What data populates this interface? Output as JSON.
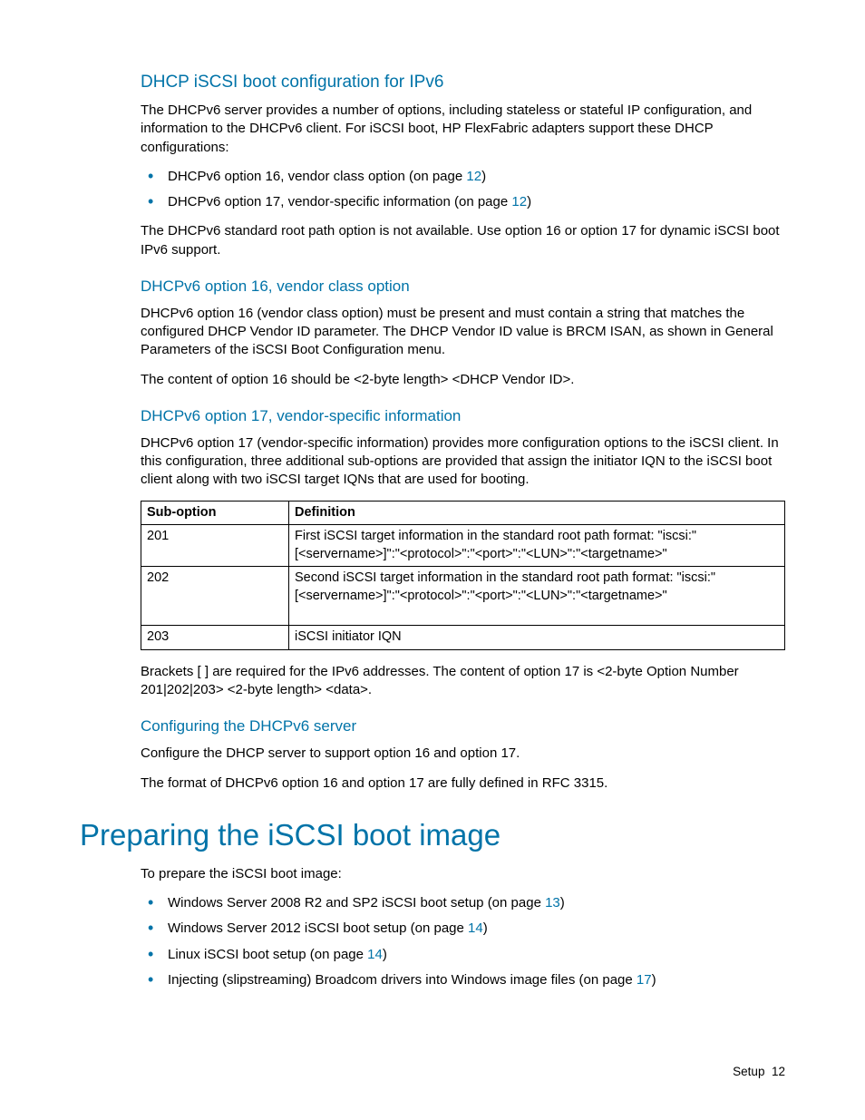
{
  "sec1": {
    "title": "DHCP iSCSI boot configuration for IPv6",
    "p1": "The DHCPv6 server provides a number of options, including stateless or stateful IP configuration, and information to the DHCPv6 client. For iSCSI boot, HP FlexFabric adapters support these DHCP configurations:",
    "bullets": [
      {
        "text_a": "DHCPv6 option 16, vendor class option (on page ",
        "link": "12",
        "text_b": ")"
      },
      {
        "text_a": "DHCPv6 option 17, vendor-specific information (on page ",
        "link": "12",
        "text_b": ")"
      }
    ],
    "p2": "The DHCPv6 standard root path option is not available. Use option 16 or option 17 for dynamic iSCSI boot IPv6 support."
  },
  "sec2": {
    "title": "DHCPv6 option 16, vendor class option",
    "p1": "DHCPv6 option 16 (vendor class option) must be present and must contain a string that matches the configured DHCP Vendor ID parameter. The DHCP Vendor ID value is BRCM ISAN, as shown in General Parameters of the iSCSI Boot Configuration menu.",
    "p2": "The content of option 16 should be <2-byte length> <DHCP Vendor ID>."
  },
  "sec3": {
    "title": "DHCPv6 option 17, vendor-specific information",
    "p1": "DHCPv6 option 17 (vendor-specific information) provides more configuration options to the iSCSI client. In this configuration, three additional sub-options are provided that assign the initiator IQN to the iSCSI boot client along with two iSCSI target IQNs that are used for booting.",
    "table": {
      "h1": "Sub-option",
      "h2": "Definition",
      "rows": [
        {
          "c1": "201",
          "c2": "First iSCSI target information in the standard root path format: \"iscsi:\"[<servername>]\":\"<protocol>\":\"<port>\":\"<LUN>\":\"<targetname>\""
        },
        {
          "c1": "202",
          "c2": "Second iSCSI target information in the standard root path format: \"iscsi:\"[<servername>]\":\"<protocol>\":\"<port>\":\"<LUN>\":\"<targetname>\"",
          "pad": true
        },
        {
          "c1": "203",
          "c2": "iSCSI initiator IQN"
        }
      ]
    },
    "p2": "Brackets [ ] are required for the IPv6 addresses. The content of option 17 is <2-byte Option Number 201|202|203> <2-byte length> <data>."
  },
  "sec4": {
    "title": "Configuring the DHCPv6 server",
    "p1": "Configure the DHCP server to support option 16 and option 17.",
    "p2": "The format of DHCPv6 option 16 and option 17 are fully defined in RFC 3315."
  },
  "sec5": {
    "title": "Preparing the iSCSI boot image",
    "p1": "To prepare the iSCSI boot image:",
    "bullets": [
      {
        "text_a": "Windows Server 2008 R2 and SP2 iSCSI boot setup (on page ",
        "link": "13",
        "text_b": ")"
      },
      {
        "text_a": "Windows Server 2012 iSCSI boot setup (on page ",
        "link": "14",
        "text_b": ")"
      },
      {
        "text_a": "Linux iSCSI boot setup (on page ",
        "link": "14",
        "text_b": ")"
      },
      {
        "text_a": "Injecting (slipstreaming) Broadcom drivers into Windows image files (on page ",
        "link": "17",
        "text_b": ")"
      }
    ]
  },
  "footer": {
    "label": "Setup",
    "page": "12"
  }
}
